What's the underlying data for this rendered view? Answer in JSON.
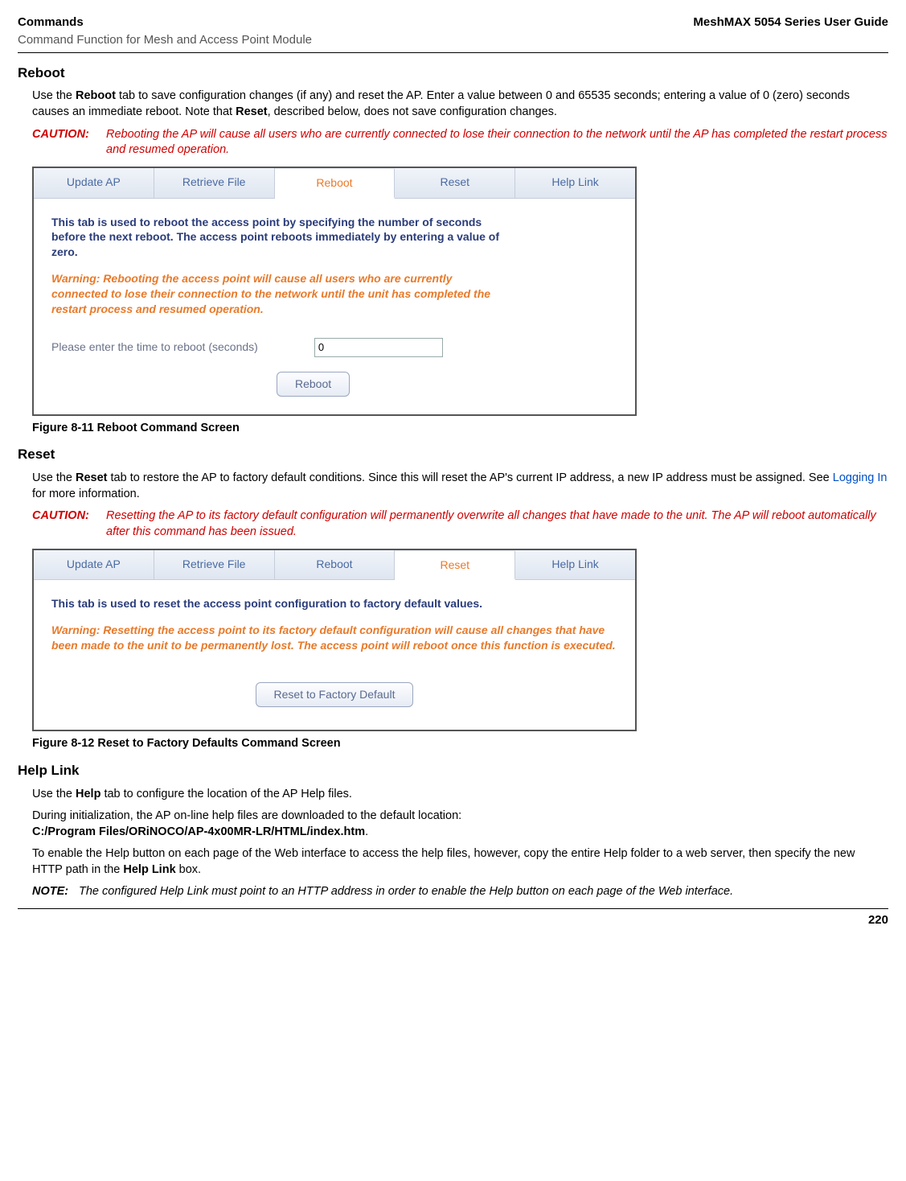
{
  "header": {
    "left_bold": "Commands",
    "right_bold": "MeshMAX 5054 Series User Guide",
    "left_sub": "Command Function for Mesh and Access Point Module"
  },
  "sections": {
    "reboot": {
      "title": "Reboot",
      "para1_a": "Use the ",
      "para1_bold1": "Reboot",
      "para1_b": " tab to save configuration changes (if any) and reset the AP. Enter a value between 0 and 65535 seconds; entering a value of 0 (zero) seconds causes an immediate reboot. Note that ",
      "para1_bold2": "Reset",
      "para1_c": ", described below, does not save configuration changes.",
      "caution_label": "CAUTION:",
      "caution_text": "Rebooting the AP will cause all users who are currently connected to lose their connection to the network until the AP has completed the restart process and resumed operation.",
      "fig_caption": "Figure 8-11 Reboot Command Screen"
    },
    "reset": {
      "title": "Reset",
      "para1_a": "Use the ",
      "para1_bold1": "Reset",
      "para1_b": " tab to restore the AP to factory default conditions. Since this will reset the AP's current IP address, a new IP address must be assigned. See ",
      "para1_link": "Logging In",
      "para1_c": " for more information.",
      "caution_label": "CAUTION:",
      "caution_text": "Resetting the AP to its factory default configuration will permanently overwrite all changes that have made to the unit. The AP will reboot automatically after this command has been issued.",
      "fig_caption": "Figure 8-12 Reset to Factory Defaults Command Screen"
    },
    "help": {
      "title": "Help Link",
      "p1_a": "Use the ",
      "p1_bold": "Help",
      "p1_b": " tab to configure the location of the AP Help files.",
      "p2_a": "During initialization, the AP on-line help files are downloaded to the default location:",
      "p2_bold": "C:/Program Files/ORiNOCO/AP-4x00MR-LR/HTML/index.htm",
      "p2_b": ".",
      "p3_a": "To enable the Help button on each page of the Web interface to access the help files, however, copy the entire Help folder to a web server, then specify the new HTTP path in the ",
      "p3_bold": "Help Link",
      "p3_b": " box.",
      "note_label": "NOTE:",
      "note_text": "The configured Help Link must point to an HTTP address in order to enable the Help button on each page of the Web interface."
    }
  },
  "reboot_ui": {
    "tabs": [
      "Update AP",
      "Retrieve File",
      "Reboot",
      "Reset",
      "Help Link"
    ],
    "active": "Reboot",
    "desc": "This tab is used to reboot the access point by specifying the number of seconds before the next reboot. The access point reboots immediately by entering a value of zero.",
    "warn": "Warning: Rebooting the access point will cause all users who are currently connected to lose their connection to the network until the unit has completed the restart process and resumed operation.",
    "prompt": "Please enter the time to reboot (seconds)",
    "input_value": "0",
    "button": "Reboot"
  },
  "reset_ui": {
    "tabs": [
      "Update AP",
      "Retrieve File",
      "Reboot",
      "Reset",
      "Help Link"
    ],
    "active": "Reset",
    "desc": "This tab is used to reset the access point configuration to factory default values.",
    "warn": "Warning: Resetting the access point to its factory default configuration will cause all changes that have been made to the unit to be permanently lost. The access point will reboot once this function is executed.",
    "button": "Reset to Factory Default"
  },
  "page_number": "220"
}
